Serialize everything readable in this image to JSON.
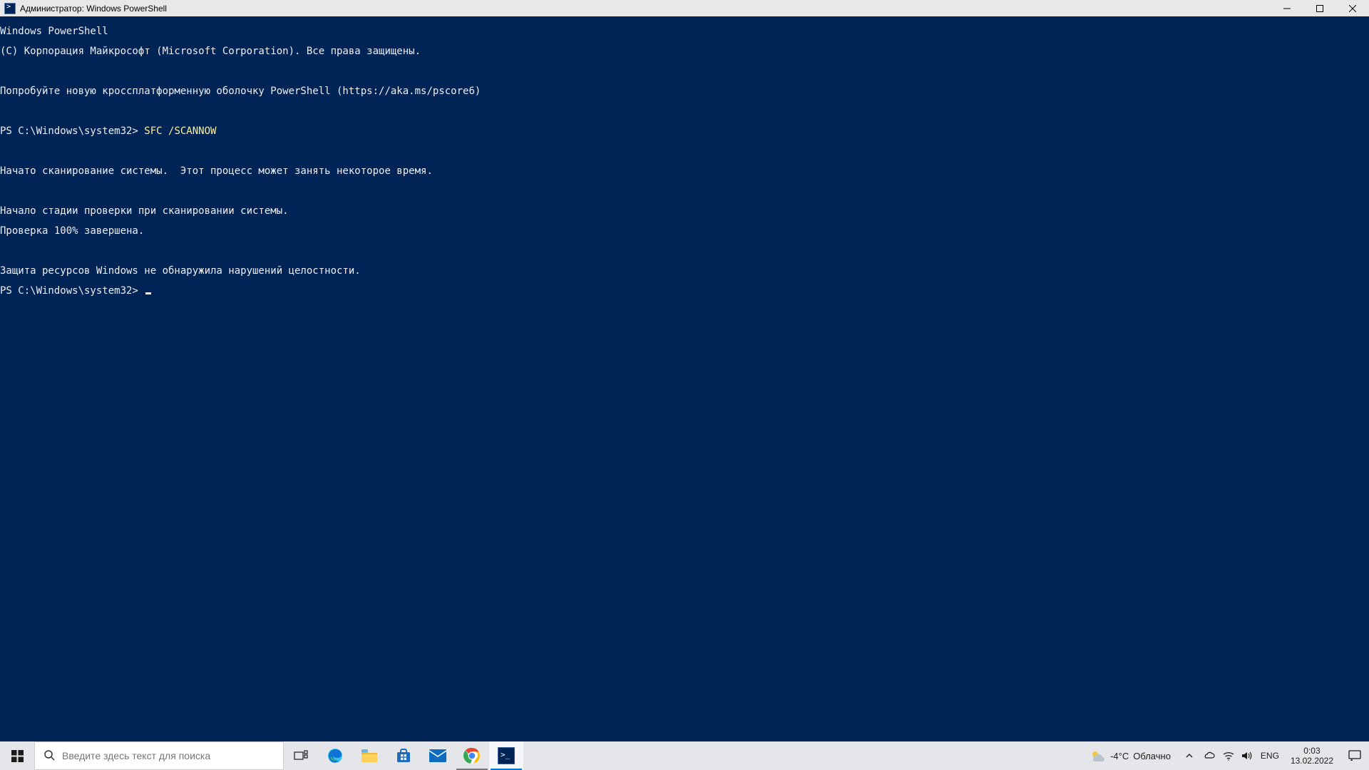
{
  "window": {
    "title": "Администратор: Windows PowerShell"
  },
  "console": {
    "line1": "Windows PowerShell",
    "line2": "(C) Корпорация Майкрософт (Microsoft Corporation). Все права защищены.",
    "line3": "",
    "line4": "Попробуйте новую кроссплатформенную оболочку PowerShell (https://aka.ms/pscore6)",
    "line5": "",
    "prompt1_prefix": "PS C:\\Windows\\system32> ",
    "prompt1_cmd": "SFC /SCANNOW",
    "line7": "",
    "line8": "Начато сканирование системы.  Этот процесс может занять некоторое время.",
    "line9": "",
    "line10": "Начало стадии проверки при сканировании системы.",
    "line11": "Проверка 100% завершена.",
    "line12": "",
    "line13": "Защита ресурсов Windows не обнаружила нарушений целостности.",
    "prompt2": "PS C:\\Windows\\system32> "
  },
  "taskbar": {
    "search_placeholder": "Введите здесь текст для поиска",
    "weather_temp": "-4°C",
    "weather_text": "Облачно",
    "lang": "ENG",
    "time": "0:03",
    "date": "13.02.2022"
  }
}
